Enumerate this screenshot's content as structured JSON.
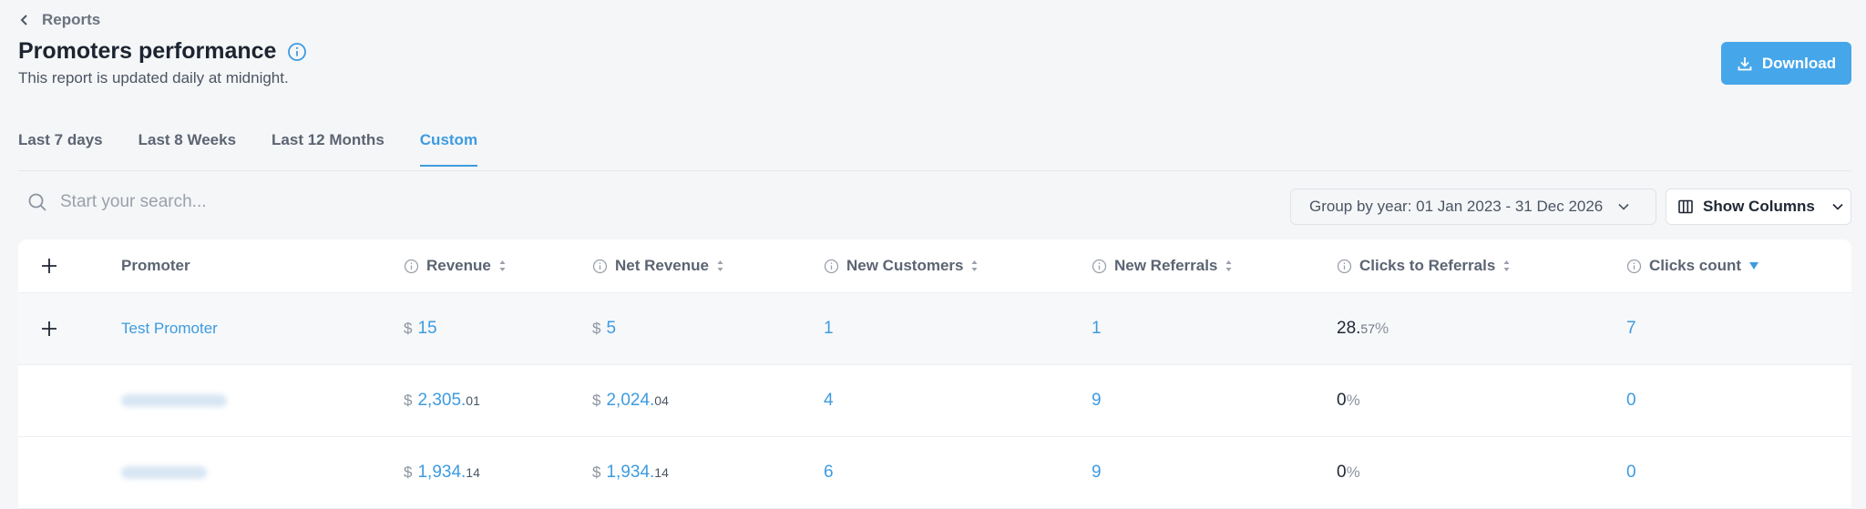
{
  "breadcrumb": {
    "back_label": "Reports"
  },
  "header": {
    "title": "Promoters performance",
    "subtitle": "This report is updated daily at midnight.",
    "download_label": "Download"
  },
  "tabs": [
    {
      "label": "Last 7 days",
      "active": false
    },
    {
      "label": "Last 8 Weeks",
      "active": false
    },
    {
      "label": "Last 12 Months",
      "active": false
    },
    {
      "label": "Custom",
      "active": true
    }
  ],
  "toolbar": {
    "search_placeholder": "Start your search...",
    "group_by_label": "Group by year: 01 Jan 2023 - 31 Dec 2026",
    "show_columns_label": "Show Columns"
  },
  "table": {
    "columns": [
      "Promoter",
      "Revenue",
      "Net Revenue",
      "New Customers",
      "New Referrals",
      "Clicks to Referrals",
      "Clicks count"
    ],
    "sorted_column": "Clicks count",
    "currency": "$",
    "percent_sign": "%",
    "rows": [
      {
        "promoter": "Test Promoter",
        "revenue_int": "15",
        "revenue_dec": "",
        "net_int": "5",
        "net_dec": "",
        "new_customers": "1",
        "new_referrals": "1",
        "ctr_int": "28.",
        "ctr_dec": "57",
        "clicks": "7"
      },
      {
        "promoter": "",
        "revenue_int": "2,305.",
        "revenue_dec": "01",
        "net_int": "2,024.",
        "net_dec": "04",
        "new_customers": "4",
        "new_referrals": "9",
        "ctr_int": "0",
        "ctr_dec": "",
        "clicks": "0"
      },
      {
        "promoter": "",
        "revenue_int": "1,934.",
        "revenue_dec": "14",
        "net_int": "1,934.",
        "net_dec": "14",
        "new_customers": "6",
        "new_referrals": "9",
        "ctr_int": "0",
        "ctr_dec": "",
        "clicks": "0"
      }
    ]
  },
  "colors": {
    "accent": "#3d9be0",
    "download_bg": "#46a6ea",
    "page_bg": "#f5f6f8"
  }
}
